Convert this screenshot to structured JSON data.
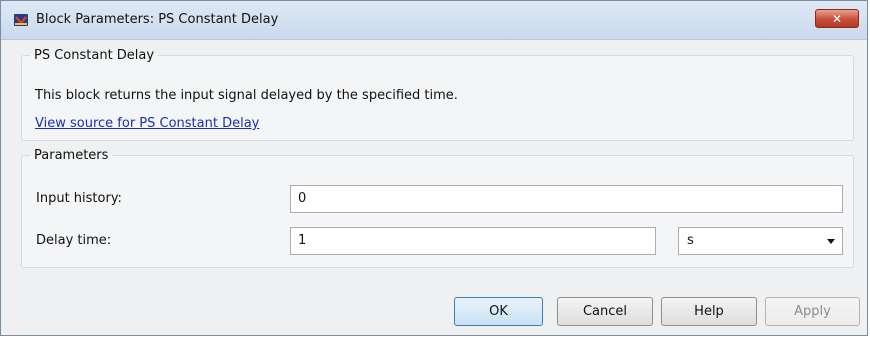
{
  "window": {
    "title": "Block Parameters: PS Constant Delay",
    "close_symbol": "✕"
  },
  "description_group": {
    "legend": "PS Constant Delay",
    "description": "This block returns the input signal delayed by the specified time.",
    "source_link": "View source for PS Constant Delay"
  },
  "parameters_group": {
    "legend": "Parameters",
    "input_history": {
      "label": "Input history:",
      "value": "0"
    },
    "delay_time": {
      "label": "Delay time:",
      "value": "1",
      "unit": "s"
    }
  },
  "buttons": {
    "ok": "OK",
    "cancel": "Cancel",
    "help": "Help",
    "apply": "Apply"
  },
  "colors": {
    "link": "#1a2fb0",
    "title_bar": "#c9d9ec",
    "close_button": "#c7503a",
    "default_button": "#c9e2f5"
  }
}
